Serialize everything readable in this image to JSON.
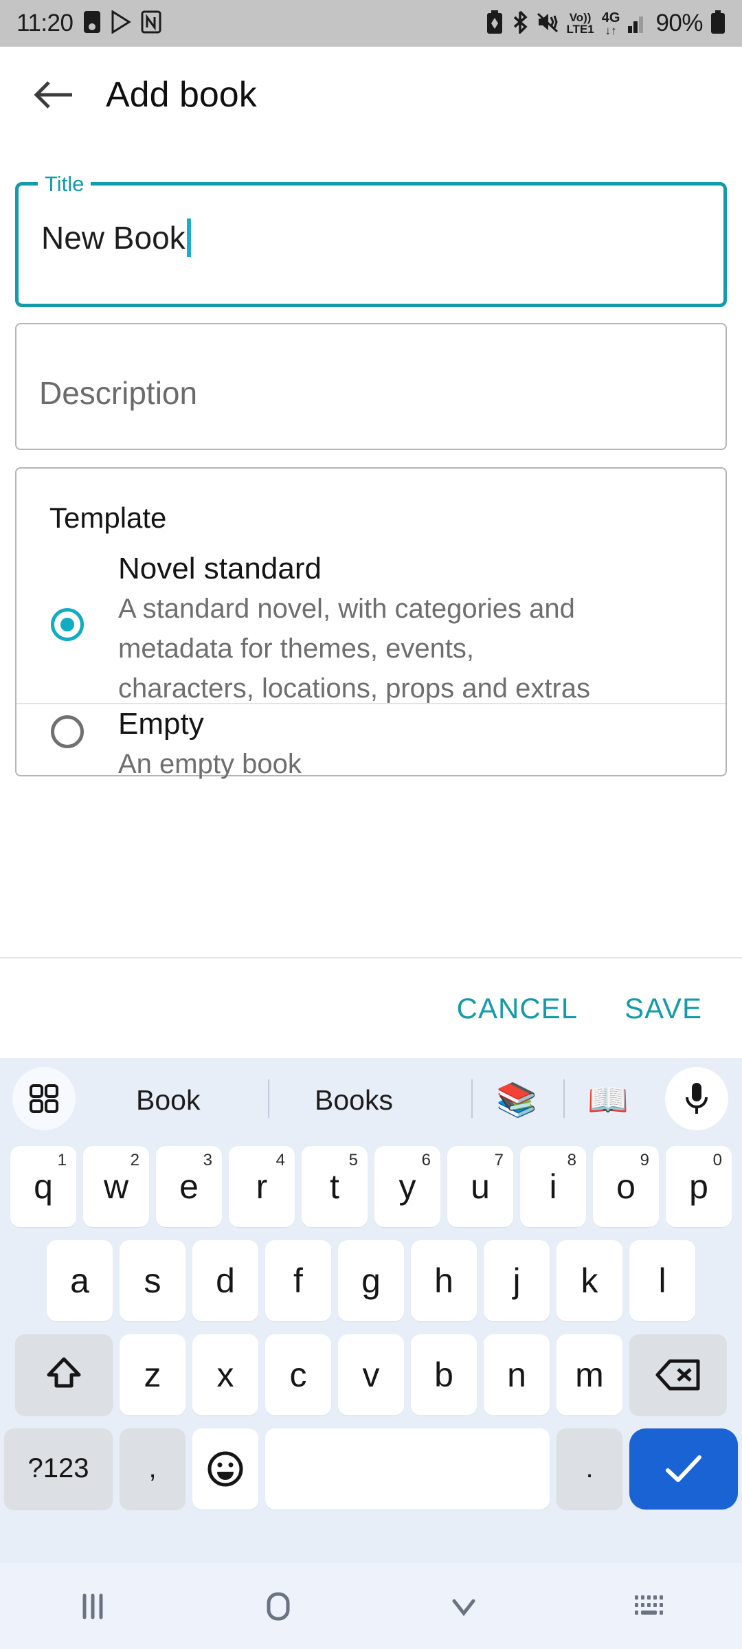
{
  "status_bar": {
    "time": "11:20",
    "battery_percent": "90%",
    "left_icons": [
      "sim-card-icon",
      "play-protect-icon",
      "notion-icon"
    ],
    "right_icons": [
      "battery-saver-icon",
      "bluetooth-icon",
      "mute-vibrate-icon",
      "volte-lte1-icon",
      "4g-data-icon",
      "signal-bars-icon",
      "battery-icon"
    ],
    "network": {
      "volte": "Vo))",
      "lte": "LTE1",
      "gen": "4G"
    },
    "background": "#c4c4c4"
  },
  "app_bar": {
    "back_label": "back-arrow",
    "title": "Add book"
  },
  "form": {
    "title_field": {
      "label": "Title",
      "value": "New Book",
      "focused": true
    },
    "description_field": {
      "placeholder": "Description",
      "value": ""
    },
    "template_card": {
      "heading": "Template",
      "options": [
        {
          "name": "Novel standard",
          "description": "A standard novel, with categories and metadata for themes, events, characters, locations, props and extras",
          "selected": true
        },
        {
          "name": "Empty",
          "description": "An empty book",
          "selected": false
        }
      ]
    }
  },
  "actions": {
    "cancel_label": "CANCEL",
    "save_label": "SAVE"
  },
  "theme": {
    "accent": "#139AAB",
    "radio_accent": "#10ACC2",
    "enter_key": "#1a63d4"
  },
  "keyboard": {
    "suggestions": {
      "grid_icon": "grid-menu-icon",
      "word_1": "Book",
      "word_2": "Books",
      "emoji_1": "📚",
      "emoji_2": "📖",
      "mic_icon": "microphone-icon"
    },
    "row1": [
      {
        "letter": "q",
        "sup": "1"
      },
      {
        "letter": "w",
        "sup": "2"
      },
      {
        "letter": "e",
        "sup": "3"
      },
      {
        "letter": "r",
        "sup": "4"
      },
      {
        "letter": "t",
        "sup": "5"
      },
      {
        "letter": "y",
        "sup": "6"
      },
      {
        "letter": "u",
        "sup": "7"
      },
      {
        "letter": "i",
        "sup": "8"
      },
      {
        "letter": "o",
        "sup": "9"
      },
      {
        "letter": "p",
        "sup": "0"
      }
    ],
    "row2": [
      "a",
      "s",
      "d",
      "f",
      "g",
      "h",
      "j",
      "k",
      "l"
    ],
    "row3": {
      "shift": "shift-icon",
      "letters": [
        "z",
        "x",
        "c",
        "v",
        "b",
        "n",
        "m"
      ],
      "backspace": "backspace-icon"
    },
    "row4": {
      "symbols_label": "?123",
      "comma": ",",
      "emoji_key": "emoji-icon",
      "space": "",
      "period": ".",
      "enter": "checkmark-icon"
    }
  },
  "nav_bar": {
    "recents": "recents-icon",
    "home": "home-icon",
    "hide_keyboard": "chevron-down-icon",
    "keyboard_switch": "keyboard-switch-icon"
  }
}
